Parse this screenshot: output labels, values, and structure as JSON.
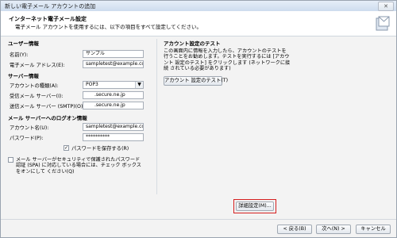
{
  "window": {
    "title": "新しい電子メール アカウントの追加",
    "close_label": "✕"
  },
  "header": {
    "title": "インターネット電子メール設定",
    "subtitle": "電子メール アカウントを使用するには、以下の項目をすべて設定してください。"
  },
  "user_info": {
    "section": "ユーザー情報",
    "name_label": "名前(Y):",
    "name_value": "サンプル",
    "email_label": "電子メール アドレス(E):",
    "email_value": "sampletest@example.com"
  },
  "server_info": {
    "section": "サーバー情報",
    "account_type_label": "アカウントの種類(A):",
    "account_type_value": "POP3",
    "incoming_label": "受信メール サーバー(I):",
    "incoming_value": ".secure.ne.jp",
    "outgoing_label": "送信メール サーバー (SMTP)(O):",
    "outgoing_value": ".secure.ne.jp"
  },
  "login_info": {
    "section": "メール サーバーへのログオン情報",
    "account_label": "アカウント名(U):",
    "account_value": "sampletest@example.com",
    "password_label": "パスワード(P):",
    "password_value": "**********",
    "save_password_label": "パスワードを保存する(R)",
    "save_password_checked": true,
    "spa_label": "メール サーバーがセキュリティで保護されたパスワード認証 (SPA) に対応している場合には、チェック ボックスをオンにして ください(Q)",
    "spa_checked": false
  },
  "test": {
    "section": "アカウント設定のテスト",
    "description": "この画面内に情報を入力したら、アカウントのテストを 行うことをお勧めします。テストを実行するには [アカウント 設定のテスト] をクリックします (ネットワークに接続 されている必要があります)",
    "button_label": "アカウント 設定のテスト(T)"
  },
  "advanced_button_label": "詳細設定(M)...",
  "footer": {
    "back_label": "< 戻る(B)",
    "next_label": "次へ(N) >",
    "cancel_label": "キャンセル"
  },
  "icons": [
    "close-icon",
    "mail-account-icon",
    "dropdown-arrow-icon",
    "checkmark-icon"
  ]
}
